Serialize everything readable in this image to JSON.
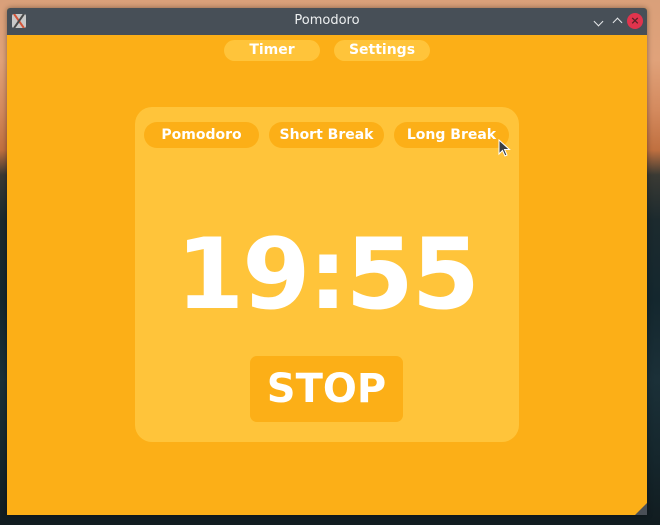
{
  "window": {
    "title": "Pomodoro",
    "controls": {
      "minimize_icon": "chevron-down-icon",
      "maximize_icon": "chevron-up-icon",
      "close_icon": "close-icon",
      "close_glyph": "×"
    }
  },
  "nav": {
    "items": [
      {
        "label": "Timer"
      },
      {
        "label": "Settings"
      }
    ]
  },
  "modes": [
    {
      "label": "Pomodoro"
    },
    {
      "label": "Short Break"
    },
    {
      "label": "Long Break"
    }
  ],
  "timer": {
    "display": "19:55"
  },
  "actions": {
    "stop_label": "STOP"
  },
  "colors": {
    "window_bg": "#fcaf17",
    "card_bg": "#ffc43a",
    "titlebar_bg": "#474f57",
    "close_button": "#e0344d",
    "text": "#ffffff"
  }
}
